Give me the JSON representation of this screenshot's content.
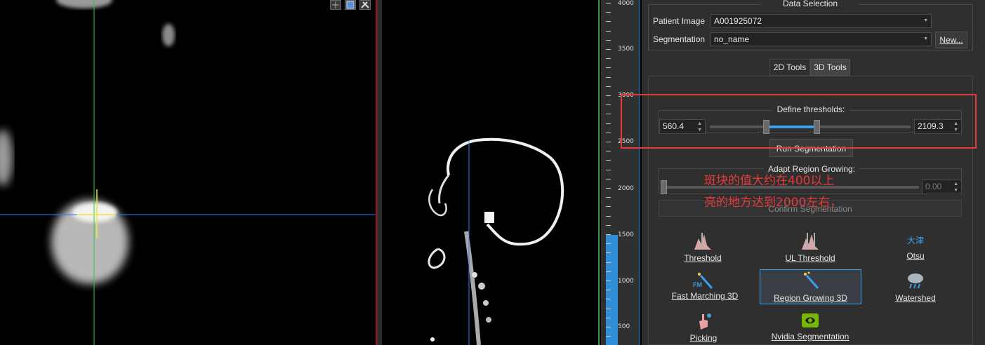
{
  "ruler": {
    "labels": [
      "4000",
      "3500",
      "3000",
      "2500",
      "2000",
      "1500",
      "1000",
      "500"
    ]
  },
  "data_selection": {
    "title": "Data Selection",
    "patient_image_label": "Patient Image",
    "patient_image_value": "A001925072",
    "segmentation_label": "Segmentation",
    "segmentation_value": "no_name",
    "new_button": "New..."
  },
  "tabs": {
    "tab_2d": "2D Tools",
    "tab_3d": "3D Tools"
  },
  "thresholds": {
    "title": "Define thresholds:",
    "lower": "560.4",
    "upper": "2109.3",
    "lower_fraction": 0.28,
    "upper_fraction": 0.53,
    "run_button": "Run Segmentation"
  },
  "region_growing": {
    "title": "Adapt Region Growing:",
    "value": "0.00",
    "confirm_button": "Confirm Segmentation"
  },
  "annotation": {
    "line1": "斑块的值大约在400以上",
    "line2": "亮的地方达到2000左右，"
  },
  "tools": {
    "threshold": "Threshold",
    "ul_threshold": "UL Threshold",
    "otsu": "Otsu",
    "otsu_icon_text": "大津",
    "fast_marching": "Fast Marching 3D",
    "fm_icon_text": "FM",
    "region_growing_3d": "Region Growing 3D",
    "watershed": "Watershed",
    "picking": "Picking",
    "nvidia": "Nvidia Segmentation"
  },
  "colors": {
    "accent": "#3aa0e8",
    "annotation_red": "#e63a3a",
    "crosshair_green": "#2ecc40",
    "crosshair_blue": "#2a7fff"
  }
}
